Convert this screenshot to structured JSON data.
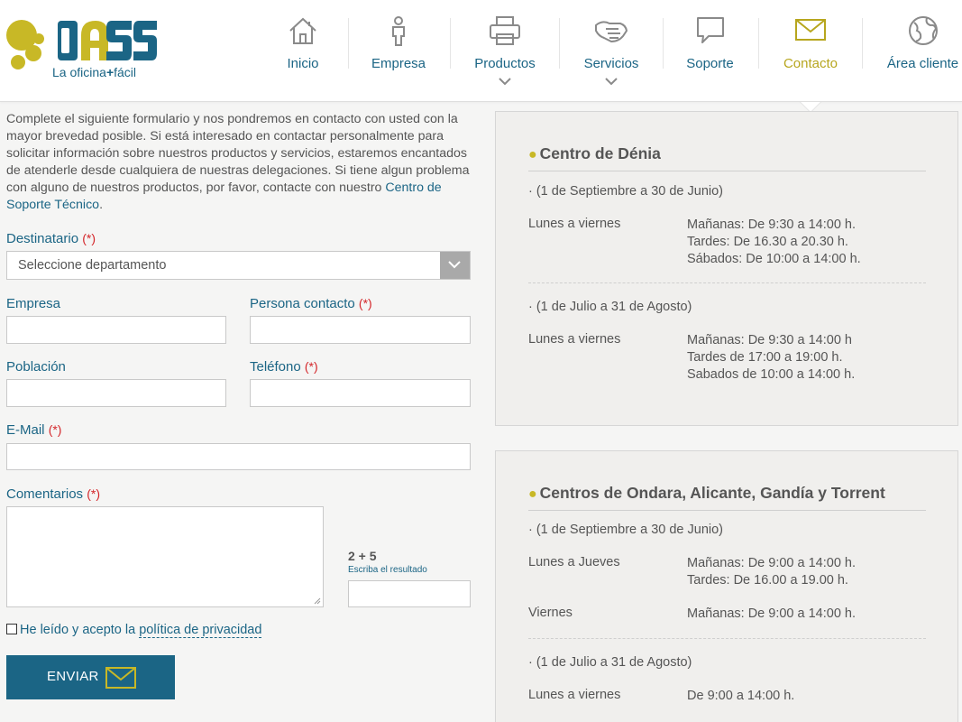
{
  "brand": {
    "logo_word": "Dass",
    "tagline_left": "La oficina",
    "tagline_plus": "+",
    "tagline_right": "fácil",
    "colors": {
      "primary": "#1b6585",
      "accent": "#c8b826",
      "required": "#d4262a"
    }
  },
  "nav": {
    "items": [
      {
        "label": "Inicio",
        "icon": "house-icon"
      },
      {
        "label": "Empresa",
        "icon": "person-icon"
      },
      {
        "label": "Productos",
        "icon": "printer-icon"
      },
      {
        "label": "Servicios",
        "icon": "handshake-icon"
      },
      {
        "label": "Soporte",
        "icon": "speech-bubble-icon"
      },
      {
        "label": "Contacto",
        "icon": "envelope-icon",
        "active": true
      },
      {
        "label": "Área cliente",
        "icon": "globe-icon"
      }
    ]
  },
  "form": {
    "intro_text": "Complete el siguiente formulario y nos pondremos en contacto con usted con la mayor brevedad posible. Si está interesado en contactar personalmente para solicitar información sobre nuestros productos y servicios, estaremos encantados de atenderle desde cualquiera de nuestras delegaciones. Si tiene algun problema con alguno de nuestros productos, por favor, contacte con nuestro ",
    "intro_link": "Centro de Soporte Técnico",
    "intro_end": ".",
    "required_mark": "(*)",
    "destinatario_label": "Destinatario",
    "destinatario_value": "Seleccione departamento",
    "empresa_label": "Empresa",
    "persona_label": "Persona contacto",
    "poblacion_label": "Población",
    "telefono_label": "Teléfono",
    "email_label": "E-Mail",
    "comentarios_label": "Comentarios",
    "captcha_question": "2 + 5",
    "captcha_hint": "Escriba el resultado",
    "privacy_prefix": "He leído y acepto la ",
    "privacy_link": "política de privacidad",
    "send_label": "ENVIAR"
  },
  "centers": [
    {
      "title": "Centro de Dénia",
      "periods": [
        {
          "range": "· (1 de Septiembre a 30 de Junio)",
          "rows": [
            {
              "days": "Lunes a viernes",
              "hours": [
                "Mañanas: De 9:30 a 14:00 h.",
                "Tardes: De 16.30 a 20.30 h.",
                "Sábados: De 10:00 a 14:00 h."
              ]
            }
          ]
        },
        {
          "range": "· (1 de Julio a 31 de Agosto)",
          "rows": [
            {
              "days": "Lunes a viernes",
              "hours": [
                "Mañanas: De 9:30 a 14:00 h",
                "Tardes de 17:00 a 19:00 h.",
                "Sabados de 10:00 a 14:00 h."
              ]
            }
          ]
        }
      ]
    },
    {
      "title": "Centros de Ondara, Alicante, Gandía y Torrent",
      "periods": [
        {
          "range": "· (1 de Septiembre a 30 de Junio)",
          "rows": [
            {
              "days": "Lunes a Jueves",
              "hours": [
                "Mañanas: De 9:00 a 14:00 h.",
                "Tardes: De 16.00 a 19.00 h."
              ]
            },
            {
              "days": "Viernes",
              "hours": [
                "Mañanas: De 9:00 a 14:00 h."
              ]
            }
          ]
        },
        {
          "range": "· (1 de Julio a 31 de Agosto)",
          "rows": [
            {
              "days": "Lunes a viernes",
              "hours": [
                "De 9:00 a 14:00 h."
              ]
            }
          ]
        }
      ]
    }
  ]
}
